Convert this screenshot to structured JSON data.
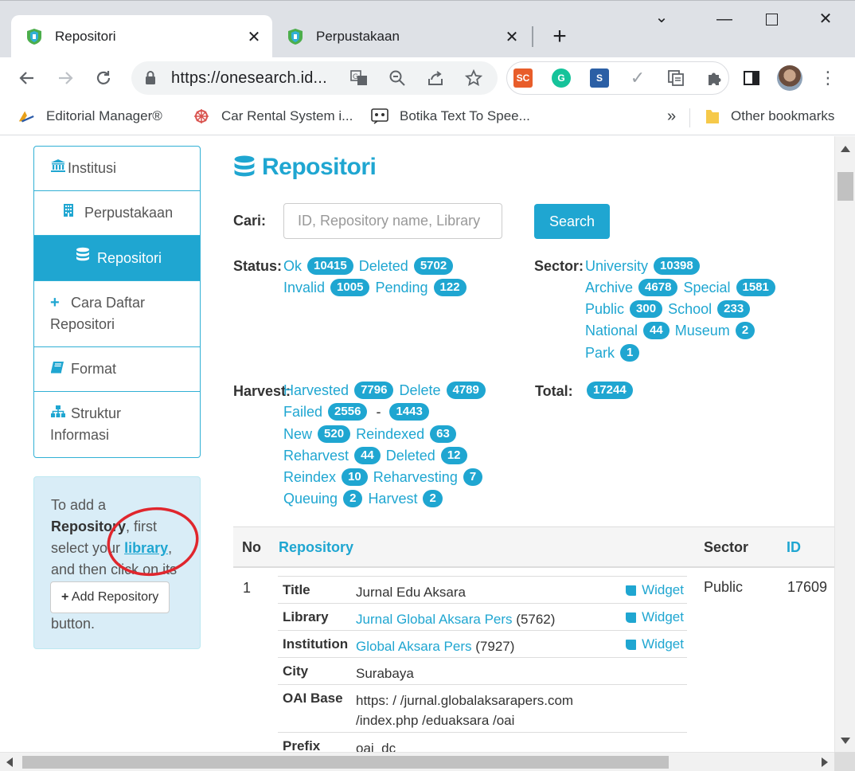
{
  "browser": {
    "tabs": [
      {
        "title": "Repositori",
        "active": true
      },
      {
        "title": "Perpustakaan",
        "active": false
      }
    ],
    "url": "https://onesearch.id...",
    "bookmarks": [
      {
        "label": "Editorial Manager®"
      },
      {
        "label": "Car Rental System i..."
      },
      {
        "label": "Botika Text To Spee..."
      }
    ],
    "more_bookmarks": "»",
    "other_bookmarks": "Other bookmarks",
    "extensions": [
      "SC",
      "Grammarly",
      "S"
    ]
  },
  "sidebar": {
    "items": [
      {
        "label": "Institusi"
      },
      {
        "label": "Perpustakaan"
      },
      {
        "label": "Repositori"
      },
      {
        "label": "Cara Daftar Repositori"
      },
      {
        "label": "Format"
      },
      {
        "label": "Struktur Informasi"
      }
    ],
    "info": {
      "t1": "To add a",
      "t2": "Repository",
      "t3": ", first select your",
      "t4": "library",
      "t5": ", and then click on its",
      "button": "Add Repository",
      "t6": "button."
    }
  },
  "main": {
    "title": "Repositori",
    "search_label": "Cari:",
    "search_placeholder": "ID, Repository name, Library",
    "search_button": "Search",
    "status_label": "Status:",
    "sector_label": "Sector:",
    "harvest_label": "Harvest:",
    "total_label": "Total:",
    "total_value": "17244",
    "status": [
      {
        "label": "Ok",
        "count": "10415"
      },
      {
        "label": "Deleted",
        "count": "5702"
      },
      {
        "label": "Invalid",
        "count": "1005"
      },
      {
        "label": "Pending",
        "count": "122"
      }
    ],
    "sector": [
      {
        "label": "University",
        "count": "10398"
      },
      {
        "label": "Archive",
        "count": "4678"
      },
      {
        "label": "Special",
        "count": "1581"
      },
      {
        "label": "Public",
        "count": "300"
      },
      {
        "label": "School",
        "count": "233"
      },
      {
        "label": "National",
        "count": "44"
      },
      {
        "label": "Museum",
        "count": "2"
      },
      {
        "label": "Park",
        "count": "1"
      }
    ],
    "harvest": [
      {
        "label": "Harvested",
        "count": "7796"
      },
      {
        "label": "Delete",
        "count": "4789"
      },
      {
        "label": "Failed",
        "count": "2556"
      },
      {
        "label": "-",
        "count": "1443"
      },
      {
        "label": "New",
        "count": "520"
      },
      {
        "label": "Reindexed",
        "count": "63"
      },
      {
        "label": "Reharvest",
        "count": "44"
      },
      {
        "label": "Deleted",
        "count": "12"
      },
      {
        "label": "Reindex",
        "count": "10"
      },
      {
        "label": "Reharvesting",
        "count": "7"
      },
      {
        "label": "Queuing",
        "count": "2"
      },
      {
        "label": "Harvest",
        "count": "2"
      }
    ]
  },
  "table": {
    "headers": {
      "no": "No",
      "repository": "Repository",
      "sector": "Sector",
      "id": "ID"
    },
    "row": {
      "no": "1",
      "sector": "Public",
      "id": "17609",
      "title_k": "Title",
      "title_v": "Jurnal Edu Aksara",
      "library_k": "Library",
      "library_v": "Jurnal Global Aksara Pers",
      "library_n": "(5762)",
      "institution_k": "Institution",
      "institution_v": "Global Aksara Pers",
      "institution_n": "(7927)",
      "city_k": "City",
      "city_v": "Surabaya",
      "oai_k": "OAI Base",
      "oai_v1": "https: / /jurnal.globalaksarapers.com",
      "oai_v2": "/index.php /eduaksara /oai",
      "prefix_k": "Prefix",
      "prefix_v": "oai_dc",
      "widget": "Widget"
    }
  }
}
